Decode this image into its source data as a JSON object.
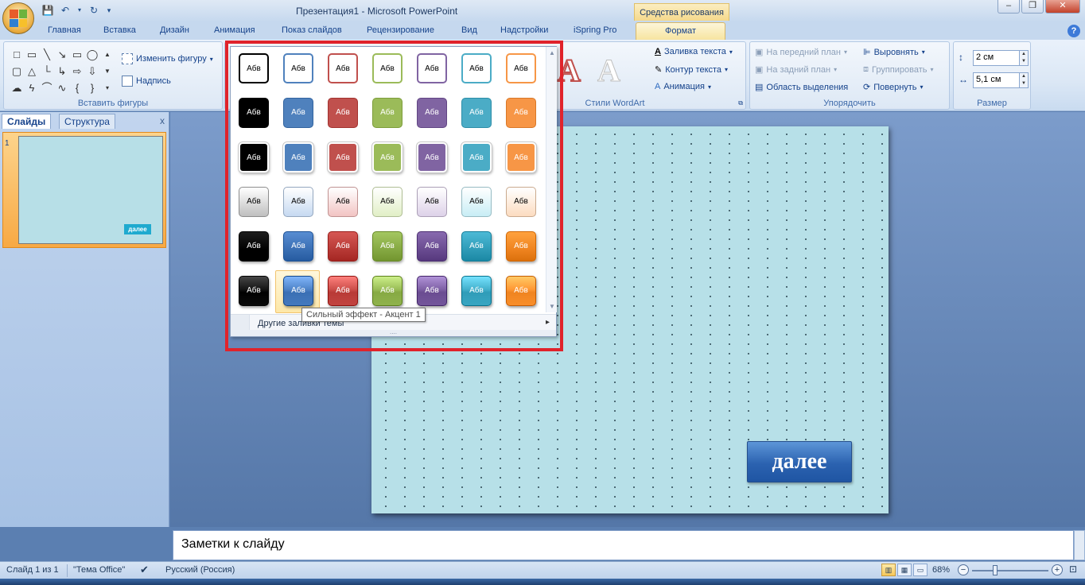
{
  "window": {
    "title": "Презентация1 - Microsoft PowerPoint",
    "context_tab_title": "Средства рисования",
    "controls": [
      "–",
      "❐",
      "✕"
    ]
  },
  "ribbon_tabs": [
    "Главная",
    "Вставка",
    "Дизайн",
    "Анимация",
    "Показ слайдов",
    "Рецензирование",
    "Вид",
    "Надстройки",
    "iSpring Pro",
    "Формат"
  ],
  "active_tab": "Формат",
  "ribbon": {
    "insert_shapes": {
      "label": "Вставить фигуры",
      "change_shape": "Изменить фигуру",
      "textbox": "Надпись"
    },
    "wordart": {
      "label": "Стили WordArt",
      "text_fill": "Заливка текста",
      "text_outline": "Контур текста",
      "animation": "Анимация"
    },
    "arrange": {
      "label": "Упорядочить",
      "bring_front": "На передний план",
      "send_back": "На задний план",
      "selection_pane": "Область выделения",
      "align": "Выровнять",
      "group": "Группировать",
      "rotate": "Повернуть"
    },
    "size": {
      "label": "Размер",
      "height": "2 см",
      "width": "5,1 см"
    }
  },
  "left_panel": {
    "tabs": [
      "Слайды",
      "Структура"
    ],
    "close": "x",
    "slide_number": "1",
    "thumb_button_text": "далее"
  },
  "slide": {
    "button_text": "далее",
    "background": "#b7e0e8"
  },
  "gallery": {
    "swatch_text": "Абв",
    "rows": [
      {
        "style": "outline",
        "colors": [
          "#000000",
          "#4f81bd",
          "#c0504d",
          "#9bbb59",
          "#8064a2",
          "#4bacc6",
          "#f79646"
        ]
      },
      {
        "style": "solid",
        "colors": [
          "#000000",
          "#4f81bd",
          "#c0504d",
          "#9bbb59",
          "#8064a2",
          "#4bacc6",
          "#f79646"
        ]
      },
      {
        "style": "solid-white-border",
        "colors": [
          "#000000",
          "#4f81bd",
          "#c0504d",
          "#9bbb59",
          "#8064a2",
          "#4bacc6",
          "#f79646"
        ]
      },
      {
        "style": "light-gradient",
        "colors": [
          "#bfbfbf",
          "#c6d9f1",
          "#f2c4c3",
          "#e1efc6",
          "#ddd1e8",
          "#c8edf5",
          "#fcdcc0"
        ]
      },
      {
        "style": "intense",
        "colors": [
          "#000000",
          "#3a6fb4",
          "#b83a36",
          "#86a943",
          "#6a4c91",
          "#2f9cb8",
          "#ef8420"
        ]
      },
      {
        "style": "intense-effect",
        "colors": [
          "#000000",
          "#3a6fb4",
          "#b83a36",
          "#86a943",
          "#6a4c91",
          "#2f9cb8",
          "#ef8420"
        ]
      }
    ],
    "more_fills": "Другие заливки темы",
    "tooltip": "Сильный эффект - Акцент 1",
    "hovered": "Сильный эффект - Акцент 1",
    "highlight_color": "#e0232b"
  },
  "notes_placeholder": "Заметки к слайду",
  "status": {
    "slide_info": "Слайд 1 из 1",
    "theme": "\"Тема Office\"",
    "language": "Русский (Россия)",
    "zoom": "68%"
  }
}
